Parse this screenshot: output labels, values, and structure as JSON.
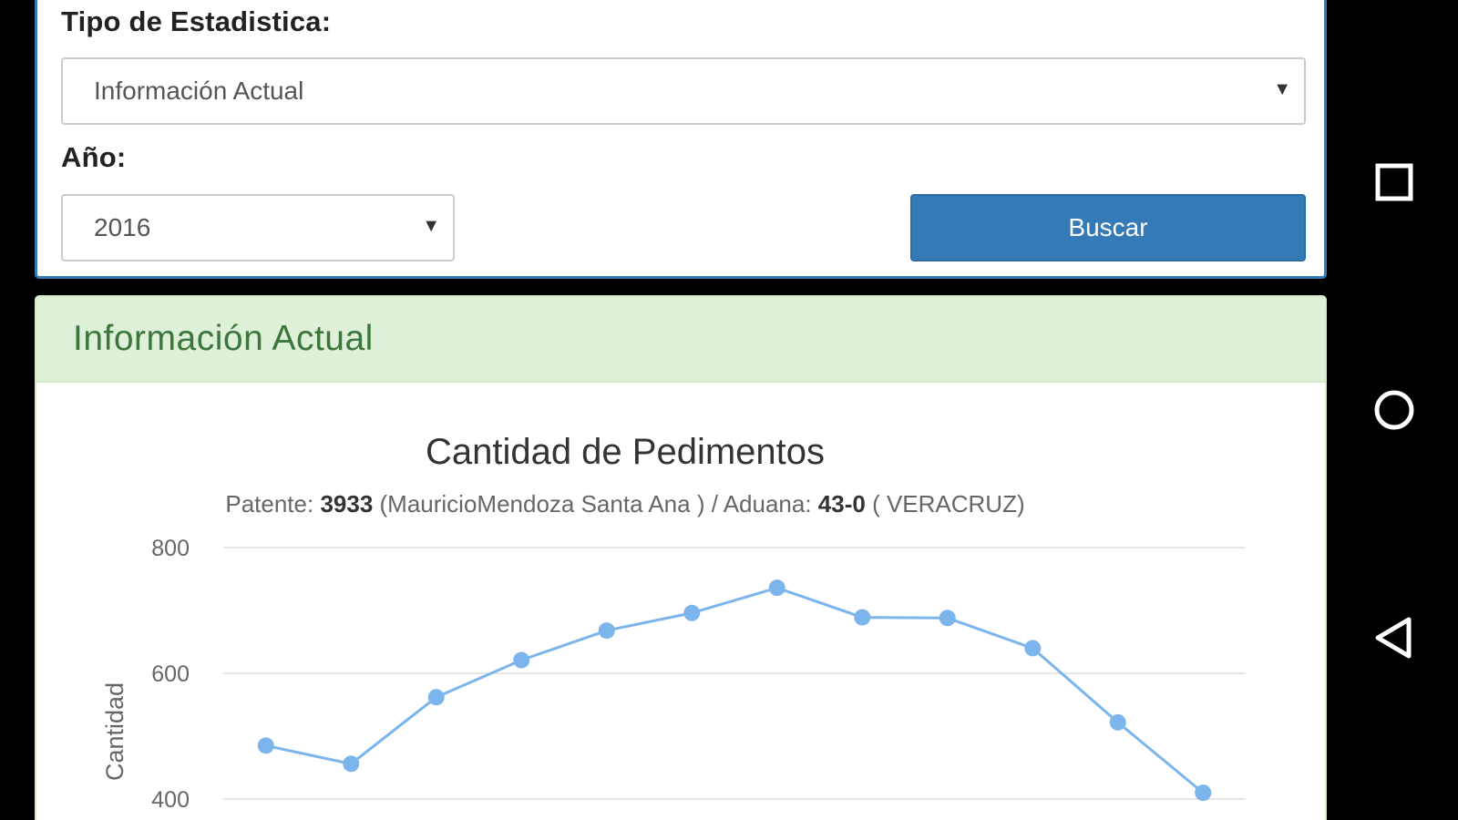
{
  "form": {
    "tipo_label": "Tipo de Estadistica:",
    "tipo_value": "Información Actual",
    "anio_label": "Año:",
    "anio_value": "2016",
    "search_label": "Buscar",
    "dropdown_arrow": "▼"
  },
  "panel": {
    "title": "Información Actual"
  },
  "chart_data": {
    "type": "line",
    "title": "Cantidad de Pedimentos",
    "subtitle": {
      "patente_label": "Patente: ",
      "patente_value": "3933",
      "patente_name": " (MauricioMendoza Santa Ana ) / Aduana: ",
      "aduana_value": "43-0",
      "aduana_name": " ( VERACRUZ)"
    },
    "xlabel": "",
    "ylabel": "Cantidad",
    "ylim": [
      400,
      800
    ],
    "y_ticks": [
      "800",
      "600",
      "400"
    ],
    "grid": true,
    "series": [
      {
        "values": [
          485,
          456,
          562,
          621,
          668,
          696,
          736,
          689,
          688,
          640,
          522,
          410
        ],
        "color": "#7cb5ec"
      }
    ]
  },
  "nav": {
    "recents_icon": "square-icon",
    "home_icon": "circle-icon",
    "back_icon": "triangle-back-icon"
  }
}
